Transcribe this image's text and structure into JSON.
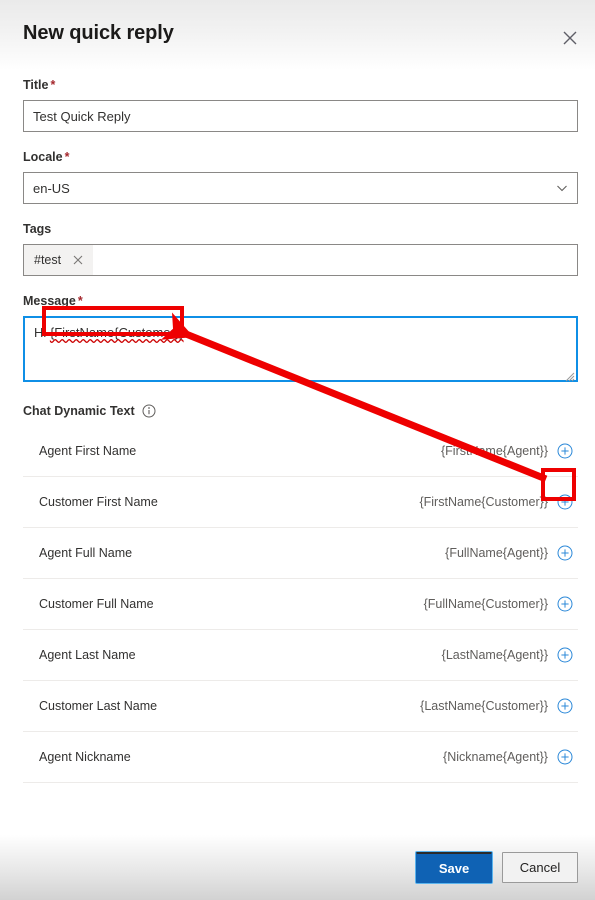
{
  "header": {
    "title": "New quick reply",
    "close_icon": "close-icon"
  },
  "form": {
    "title_field": {
      "label": "Title",
      "required_marker": "*",
      "value": "Test Quick Reply"
    },
    "locale_field": {
      "label": "Locale",
      "required_marker": "*",
      "value": "en-US",
      "chevron_icon": "chevron-down-icon"
    },
    "tags_field": {
      "label": "Tags",
      "chips": [
        {
          "text": "#test",
          "remove_icon": "close-icon"
        }
      ]
    },
    "message_field": {
      "label": "Message",
      "required_marker": "*",
      "prefix": "Hi ",
      "token": "{FirstName{Customer}}",
      "value": "Hi {FirstName{Customer}}"
    }
  },
  "chat_dynamic_text": {
    "heading": "Chat Dynamic Text",
    "info_icon": "info-circle-icon",
    "rows": [
      {
        "name": "Agent First Name",
        "token": "{FirstName{Agent}}",
        "add_icon": "plus-circle-icon"
      },
      {
        "name": "Customer First Name",
        "token": "{FirstName{Customer}}",
        "add_icon": "plus-circle-icon"
      },
      {
        "name": "Agent Full Name",
        "token": "{FullName{Agent}}",
        "add_icon": "plus-circle-icon"
      },
      {
        "name": "Customer Full Name",
        "token": "{FullName{Customer}}",
        "add_icon": "plus-circle-icon"
      },
      {
        "name": "Agent Last Name",
        "token": "{LastName{Agent}}",
        "add_icon": "plus-circle-icon"
      },
      {
        "name": "Customer Last Name",
        "token": "{LastName{Customer}}",
        "add_icon": "plus-circle-icon"
      },
      {
        "name": "Agent Nickname",
        "token": "{Nickname{Agent}}",
        "add_icon": "plus-circle-icon"
      }
    ]
  },
  "footer": {
    "save_label": "Save",
    "cancel_label": "Cancel"
  },
  "annotations": {
    "highlight_color": "#ee0000",
    "arrow": "arrow pointing from the Customer First Name add button up-left to the inserted token in the Message box"
  },
  "colors": {
    "primary_button": "#0f62b4",
    "focus_border": "#0f8fe6",
    "required_asterisk": "#a4262c",
    "icon_blue": "#2b88d8",
    "annotation_red": "#ee0000"
  }
}
